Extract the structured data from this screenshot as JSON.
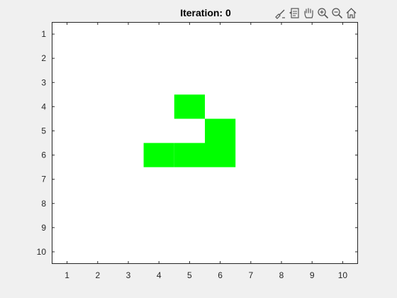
{
  "figure": {
    "title": "Iteration: 0",
    "colors": {
      "live": "#00ff00",
      "dead": "#ffffff",
      "axes_border": "#262626",
      "background": "#f0f0f0"
    }
  },
  "toolbar": {
    "buttons": [
      {
        "name": "brush-icon"
      },
      {
        "name": "data-tips-icon"
      },
      {
        "name": "pan-hand-icon"
      },
      {
        "name": "zoom-in-icon"
      },
      {
        "name": "zoom-out-icon"
      },
      {
        "name": "home-icon"
      }
    ]
  },
  "chart_data": {
    "type": "heatmap",
    "title": "Iteration: 0",
    "xlabel": "",
    "ylabel": "",
    "x_ticks": [
      1,
      2,
      3,
      4,
      5,
      6,
      7,
      8,
      9,
      10
    ],
    "y_ticks": [
      1,
      2,
      3,
      4,
      5,
      6,
      7,
      8,
      9,
      10
    ],
    "xlim": [
      0.5,
      10.5
    ],
    "ylim": [
      0.5,
      10.5
    ],
    "y_direction": "reverse",
    "grid": false,
    "live_cells": [
      {
        "row": 4,
        "col": 5
      },
      {
        "row": 5,
        "col": 6
      },
      {
        "row": 6,
        "col": 4
      },
      {
        "row": 6,
        "col": 5
      },
      {
        "row": 6,
        "col": 6
      }
    ]
  }
}
